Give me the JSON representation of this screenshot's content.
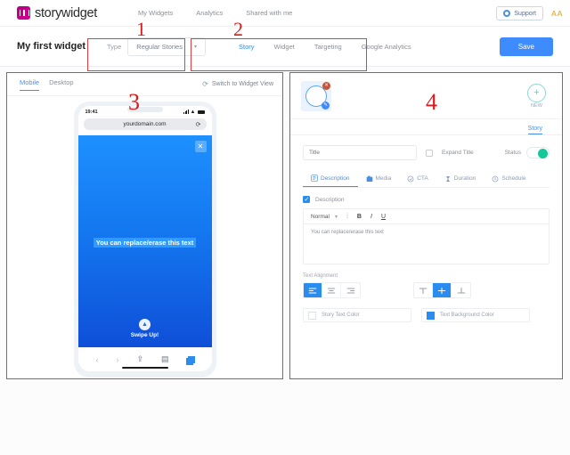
{
  "brand": {
    "name": "storywidget",
    "logo_icon": "storywidget-logo-icon"
  },
  "topnav": {
    "links": [
      {
        "label": "My Widgets"
      },
      {
        "label": "Analytics"
      },
      {
        "label": "Shared with me"
      }
    ],
    "support_label": "Support",
    "support_icon": "gear-icon",
    "avatar_initials": "AA"
  },
  "header": {
    "widget_title": "My first widget",
    "type_label": "Type",
    "type_value": "Regular Stories",
    "type_caret_icon": "chevron-down-icon",
    "tabs": [
      {
        "label": "Story",
        "active": true
      },
      {
        "label": "Widget",
        "active": false
      },
      {
        "label": "Targeting",
        "active": false
      },
      {
        "label": "Google Analytics",
        "active": false
      }
    ],
    "save_label": "Save"
  },
  "annotations": [
    {
      "number": "1"
    },
    {
      "number": "2"
    },
    {
      "number": "3"
    },
    {
      "number": "4"
    }
  ],
  "preview": {
    "view_tabs": [
      {
        "label": "Mobile",
        "active": true
      },
      {
        "label": "Desktop",
        "active": false
      }
    ],
    "switch_label": "Switch to Widget View",
    "switch_icon": "refresh-icon",
    "phone": {
      "time": "19:41",
      "url": "yourdomain.com",
      "reload_icon": "reload-icon",
      "close_icon": "close-icon",
      "story_text": "You can replace/erase this text",
      "swipe_label": "Swipe Up!",
      "swipe_icon": "chevron-up-circle-icon",
      "nav_icons": [
        "back-icon",
        "forward-icon",
        "share-icon",
        "bookmarks-icon",
        "tabs-icon"
      ]
    }
  },
  "editor": {
    "thumbnail": {
      "delete_icon": "delete-badge-icon",
      "edit_icon": "edit-badge-icon"
    },
    "new_button": {
      "icon": "plus-icon",
      "label": "NEW"
    },
    "story_tab_label": "Story",
    "title_placeholder": "Title",
    "title_value": "",
    "expand_title_label": "Expand Title",
    "expand_title_checked": false,
    "status_label": "Status",
    "status_on": true,
    "status_color": "#17c79a",
    "sub_tabs": [
      {
        "label": "Description",
        "icon": "description-icon",
        "active": true
      },
      {
        "label": "Media",
        "icon": "media-icon",
        "active": false
      },
      {
        "label": "CTA",
        "icon": "cta-icon",
        "active": false
      },
      {
        "label": "Duration",
        "icon": "duration-icon",
        "active": false
      },
      {
        "label": "Schedule",
        "icon": "schedule-icon",
        "active": false
      }
    ],
    "description_label": "Description",
    "description_checked": true,
    "toolbar": {
      "format_value": "Normal",
      "format_caret_icon": "chevron-down-icon",
      "list_icon": "list-icon",
      "bold_label": "B",
      "italic_label": "I",
      "underline_label": "U"
    },
    "body_text": "You can replace/erase this text",
    "alignment_label": "Text Alignment",
    "h_align": [
      {
        "name": "align-left",
        "active": true
      },
      {
        "name": "align-center",
        "active": false
      },
      {
        "name": "align-right",
        "active": false
      }
    ],
    "v_align": [
      {
        "name": "align-top",
        "active": false
      },
      {
        "name": "align-middle",
        "active": true
      },
      {
        "name": "align-bottom",
        "active": false
      }
    ],
    "colors": [
      {
        "label": "Story Text Color",
        "value": "#ffffff"
      },
      {
        "label": "Text Background Color",
        "value": "#2b8cf0"
      }
    ]
  }
}
